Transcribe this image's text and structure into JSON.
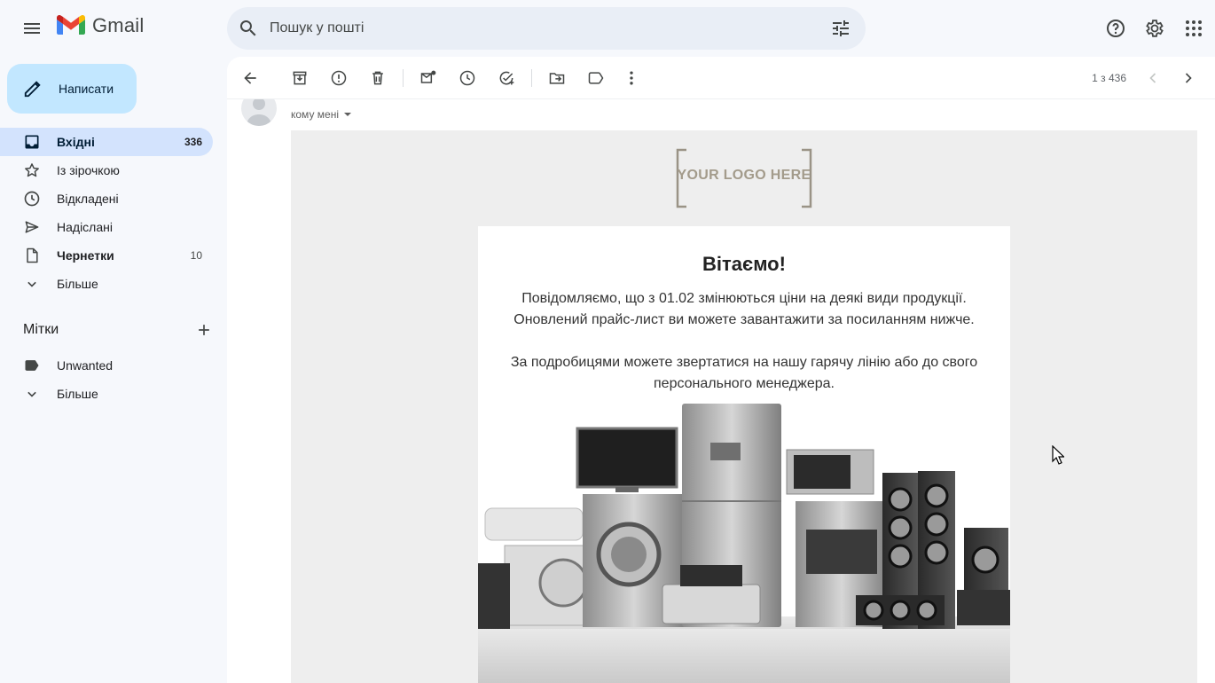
{
  "app": {
    "name": "Gmail"
  },
  "search": {
    "placeholder": "Пошук у пошті"
  },
  "compose": {
    "label": "Написати"
  },
  "nav": {
    "items": [
      {
        "label": "Вхідні",
        "count": "336",
        "icon": "inbox-icon"
      },
      {
        "label": "Із зірочкою",
        "count": "",
        "icon": "star-icon"
      },
      {
        "label": "Відкладені",
        "count": "",
        "icon": "clock-icon"
      },
      {
        "label": "Надіслані",
        "count": "",
        "icon": "send-icon"
      },
      {
        "label": "Чернетки",
        "count": "10",
        "icon": "draft-icon"
      },
      {
        "label": "Більше",
        "count": "",
        "icon": "chevron-down-icon"
      }
    ]
  },
  "labels": {
    "title": "Мітки",
    "items": [
      {
        "label": "Unwanted",
        "icon": "label-icon"
      },
      {
        "label": "Більше",
        "icon": "chevron-down-icon"
      }
    ]
  },
  "toolbar": {
    "pager": "1 з 436"
  },
  "message": {
    "to_line": "кому мені"
  },
  "email": {
    "logo_text": "YOUR LOGO HERE",
    "heading": "Вітаємо!",
    "paragraph1": "Повідомляємо, що з 01.02 змінюються ціни на деякі види продукції. Оновлений прайс-лист ви можете завантажити за посиланням нижче.",
    "paragraph2": "За подробицями можете звертатися на нашу гарячу лінію або до свого персонального менеджера."
  },
  "colors": {
    "accent": "#c2e7ff",
    "active_nav": "#d3e3fd",
    "search_bg": "#e9eef6",
    "page_bg": "#f6f8fc",
    "email_bg": "#eeeeee"
  }
}
